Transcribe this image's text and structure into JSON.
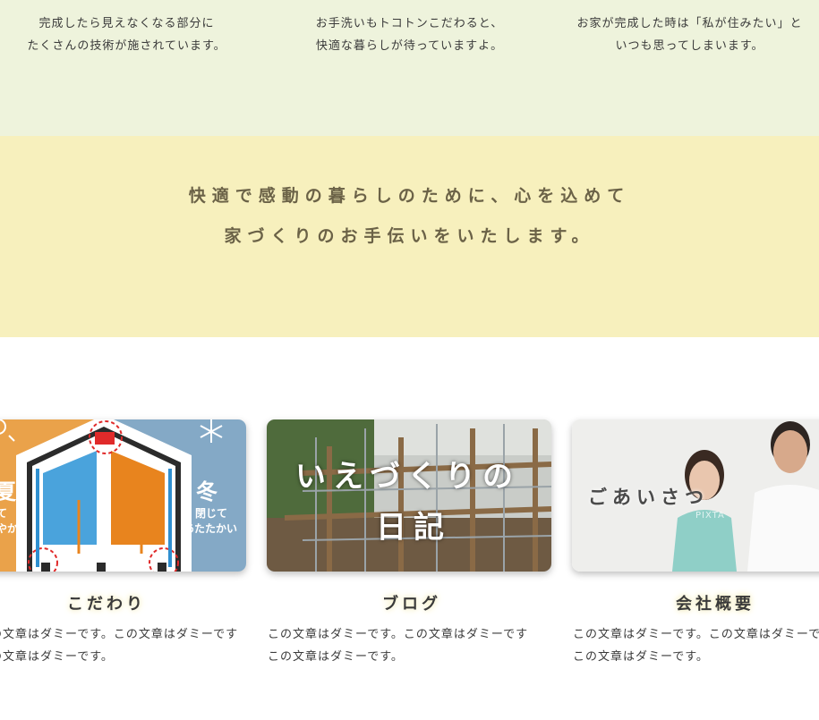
{
  "features_top": [
    {
      "line1": "完成したら見えなくなる部分に",
      "line2": "たくさんの技術が施されています。"
    },
    {
      "line1": "お手洗いもトコトンこだわると、",
      "line2": "快適な暮らしが待っていますよ。"
    },
    {
      "line1": "お家が完成した時は「私が住みたい」と",
      "line2": "いつも思ってしまいます。"
    }
  ],
  "message": {
    "line1": "快適で感動の暮らしのために、心を込めて",
    "line2": "家づくりのお手伝いをいたします。"
  },
  "cards": [
    {
      "title": "こだわり",
      "image_overlay": {
        "summer": "夏",
        "summer_sub1": "て",
        "summer_sub2": "やか",
        "winter": "冬",
        "winter_sub1": "閉じて",
        "winter_sub2": "あたたかい"
      },
      "desc1": "この文章はダミーです。この文章はダミーです",
      "desc2": "この文章はダミーです。"
    },
    {
      "title": "ブログ",
      "image_overlay": {
        "line1": "いえづくりの",
        "line2": "日記"
      },
      "desc1": "この文章はダミーです。この文章はダミーです",
      "desc2": "この文章はダミーです。"
    },
    {
      "title": "会社概要",
      "image_overlay": {
        "line1": "ごあいさつ",
        "watermark": "PIXTA"
      },
      "desc1": "この文章はダミーです。この文章はダミーです",
      "desc2": "この文章はダミーです。"
    }
  ],
  "colors": {
    "top_band": "#eef3dc",
    "message_band": "#f7f0bd",
    "summer_orange": "#eaa24a",
    "winter_blue": "#84a9c6"
  },
  "icons": [
    "sun-icon",
    "snowflake-icon"
  ]
}
